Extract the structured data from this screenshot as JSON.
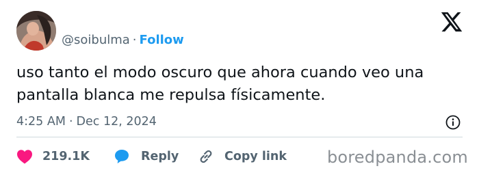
{
  "tweet": {
    "handle": "@soibulma",
    "separator": "·",
    "follow_label": "Follow",
    "text": "uso tanto el modo oscuro que ahora cuando veo una pantalla blanca me repulsa físicamente.",
    "time": "4:25 AM",
    "date_separator": "·",
    "date": "Dec 12, 2024"
  },
  "actions": {
    "likes_count": "219.1K",
    "reply_label": "Reply",
    "copy_link_label": "Copy link"
  },
  "icons": {
    "platform_logo": "x-logo-icon",
    "info": "info-icon",
    "like": "heart-icon",
    "reply": "speech-bubble-icon",
    "copy": "link-icon"
  },
  "watermark": "boredpanda.com",
  "colors": {
    "text": "#0f1419",
    "secondary": "#536471",
    "follow_blue": "#1d9bf0",
    "heart_pink": "#f91880",
    "reply_blue": "#1d9bf0",
    "divider": "#cfd9de"
  }
}
